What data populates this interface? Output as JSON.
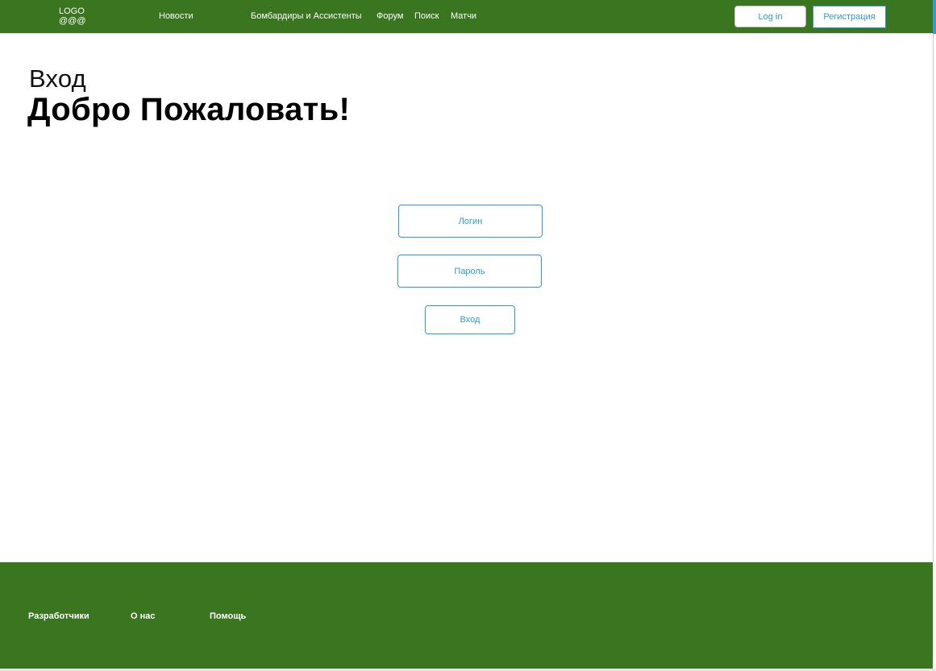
{
  "header": {
    "logo_line1": "LOGO",
    "logo_line2": "@@@",
    "nav": {
      "news": "Новости",
      "scorers": "Бомбардиры и Ассистенты",
      "forum": "Форум",
      "search": "Поиск",
      "matches": "Матчи"
    },
    "login_label": "Log in",
    "register_label": "Регистрация"
  },
  "main": {
    "subtitle": "Вход",
    "title": "Добро Пожаловать!",
    "form": {
      "login_placeholder": "Логин",
      "password_placeholder": "Пароль",
      "submit_label": "Вход"
    }
  },
  "footer": {
    "developers": "Разработчики",
    "about": "О нас",
    "help": "Помощь"
  },
  "colors": {
    "brand_green": "#3a7520",
    "accent_blue": "#2f9bd6"
  }
}
